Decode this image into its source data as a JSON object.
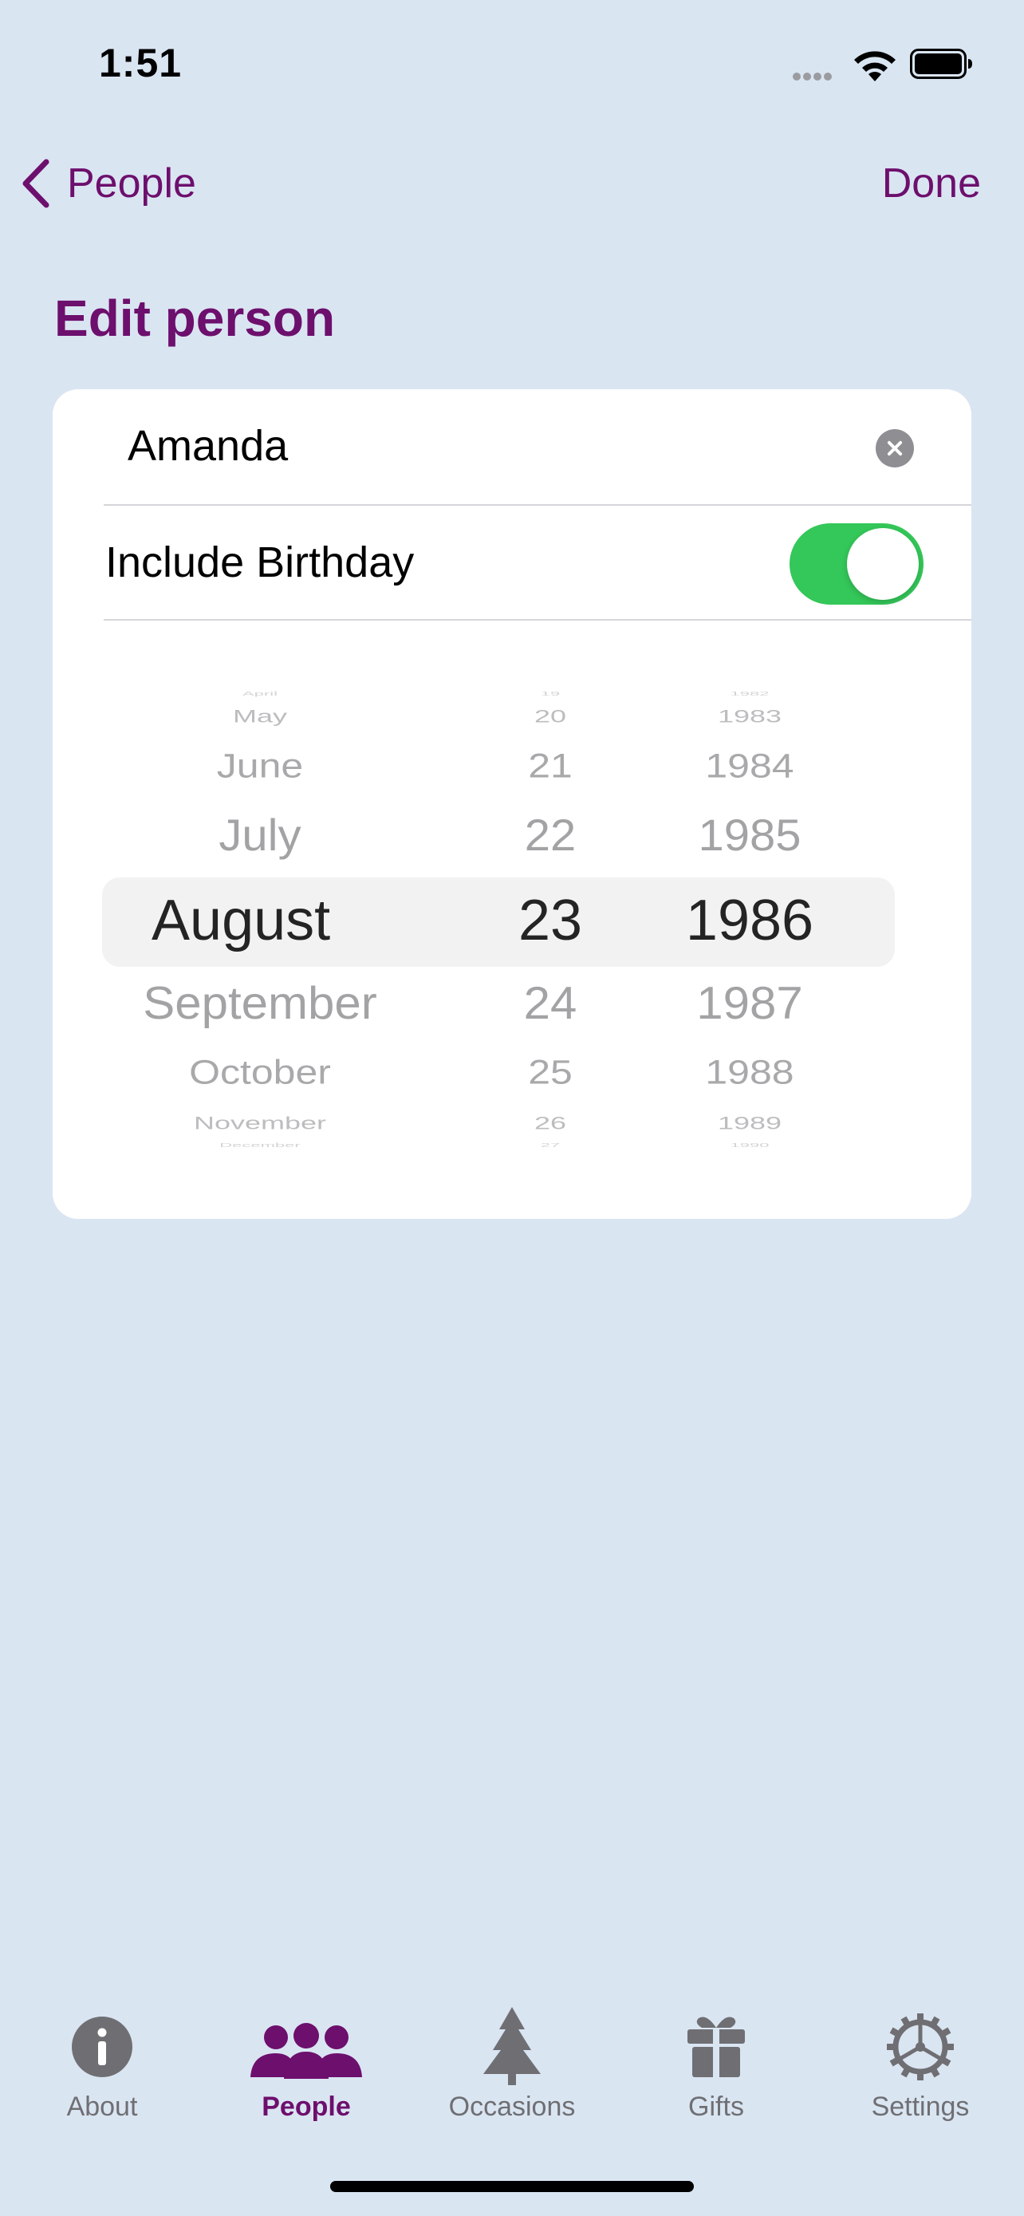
{
  "status_bar": {
    "time": "1:51"
  },
  "nav": {
    "back_label": "People",
    "done_label": "Done"
  },
  "page": {
    "title": "Edit person"
  },
  "form": {
    "name_value": "Amanda",
    "birthday_label": "Include Birthday",
    "birthday_enabled": true
  },
  "picker": {
    "months": [
      "April",
      "May",
      "June",
      "July",
      "August",
      "September",
      "October",
      "November",
      "December"
    ],
    "days": [
      "19",
      "20",
      "21",
      "22",
      "23",
      "24",
      "25",
      "26",
      "27"
    ],
    "years": [
      "1982",
      "1983",
      "1984",
      "1985",
      "1986",
      "1987",
      "1988",
      "1989",
      "1990"
    ],
    "selected": {
      "month": "August",
      "day": "23",
      "year": "1986"
    }
  },
  "tab_bar": {
    "tabs": [
      {
        "label": "About",
        "icon": "info-icon",
        "active": false
      },
      {
        "label": "People",
        "icon": "people-icon",
        "active": true
      },
      {
        "label": "Occasions",
        "icon": "tree-icon",
        "active": false
      },
      {
        "label": "Gifts",
        "icon": "gift-icon",
        "active": false
      },
      {
        "label": "Settings",
        "icon": "gear-icon",
        "active": false
      }
    ]
  },
  "colors": {
    "background": "#dae5f2",
    "accent": "#6d0f6d",
    "toggle_on": "#34c759",
    "tab_inactive": "#6f6f73"
  }
}
